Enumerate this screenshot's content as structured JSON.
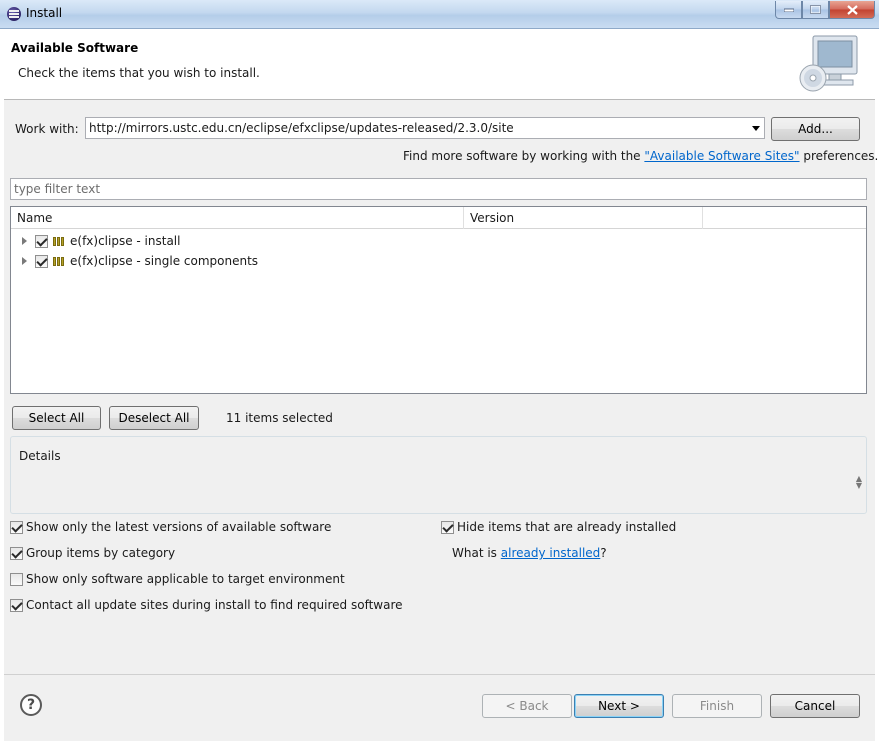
{
  "window": {
    "title": "Install"
  },
  "header": {
    "title": "Available Software",
    "description": "Check the items that you wish to install."
  },
  "work_with": {
    "label": "Work with:",
    "value": "http://mirrors.ustc.edu.cn/eclipse/efxclipse/updates-released/2.3.0/site",
    "add_button": "Add...",
    "find_more_prefix": "Find more software by working with the ",
    "find_more_link": "\"Available Software Sites\"",
    "find_more_suffix": " preferences."
  },
  "filter": {
    "placeholder": "type filter text"
  },
  "tree": {
    "columns": [
      "Name",
      "Version"
    ],
    "rows": [
      {
        "label": "e(fx)clipse - install",
        "checked": true
      },
      {
        "label": "e(fx)clipse - single components",
        "checked": true
      }
    ]
  },
  "selection": {
    "select_all": "Select All",
    "deselect_all": "Deselect All",
    "status": "11 items selected"
  },
  "details": {
    "label": "Details"
  },
  "options": {
    "show_latest": {
      "label": "Show only the latest versions of available software",
      "checked": true
    },
    "group_by_category": {
      "label": "Group items by category",
      "checked": true
    },
    "target_env": {
      "label": "Show only software applicable to target environment",
      "checked": false
    },
    "contact_sites": {
      "label": "Contact all update sites during install to find required software",
      "checked": true
    },
    "hide_installed": {
      "label": "Hide items that are already installed",
      "checked": true
    },
    "what_is_prefix": "What is ",
    "what_is_link": "already installed",
    "what_is_suffix": "?"
  },
  "footer": {
    "back": "< Back",
    "next": "Next >",
    "finish": "Finish",
    "cancel": "Cancel"
  },
  "icons": {
    "window": "eclipse-icon",
    "header": "monitor-cd-icon",
    "help": "help-icon",
    "dropdown": "dropdown-arrow-icon",
    "expander": "expand-arrow-icon",
    "feature": "feature-icon"
  }
}
